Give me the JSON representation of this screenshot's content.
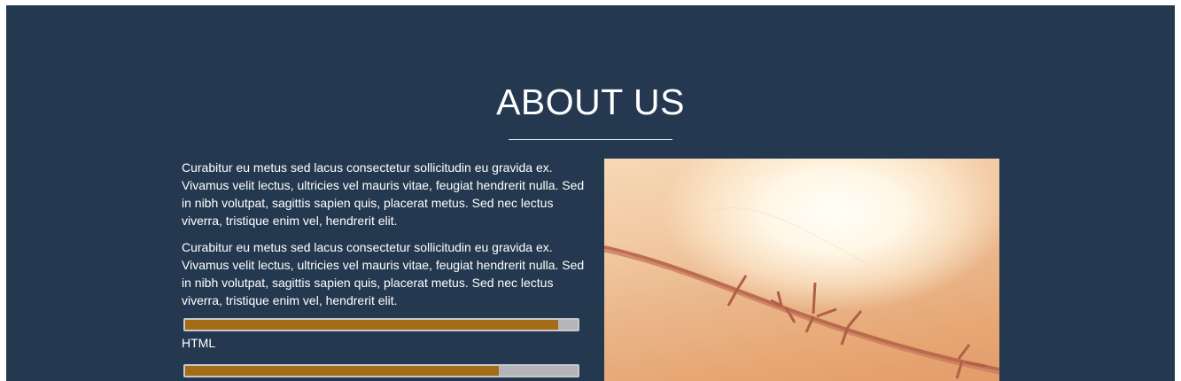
{
  "about": {
    "title": "ABOUT US",
    "paragraphs": [
      "Curabitur eu metus sed lacus consectetur sollicitudin eu gravida ex. Vivamus velit lectus, ultricies vel mauris vitae, feugiat hendrerit nulla. Sed in nibh volutpat, sagittis sapien quis, placerat metus. Sed nec lectus viverra, tristique enim vel, hendrerit elit.",
      "Curabitur eu metus sed lacus consectetur sollicitudin eu gravida ex. Vivamus velit lectus, ultricies vel mauris vitae, feugiat hendrerit nulla. Sed in nibh volutpat, sagittis sapien quis, placerat metus. Sed nec lectus viverra, tristique enim vel, hendrerit elit."
    ],
    "skills": [
      {
        "label": "HTML",
        "level_percent": 95
      },
      {
        "label": "",
        "level_percent": 80
      }
    ]
  },
  "colors": {
    "section_background": "#243950",
    "progress_fill": "#a46c17",
    "progress_track": "#b3b5b8",
    "text": "#ffffff"
  }
}
